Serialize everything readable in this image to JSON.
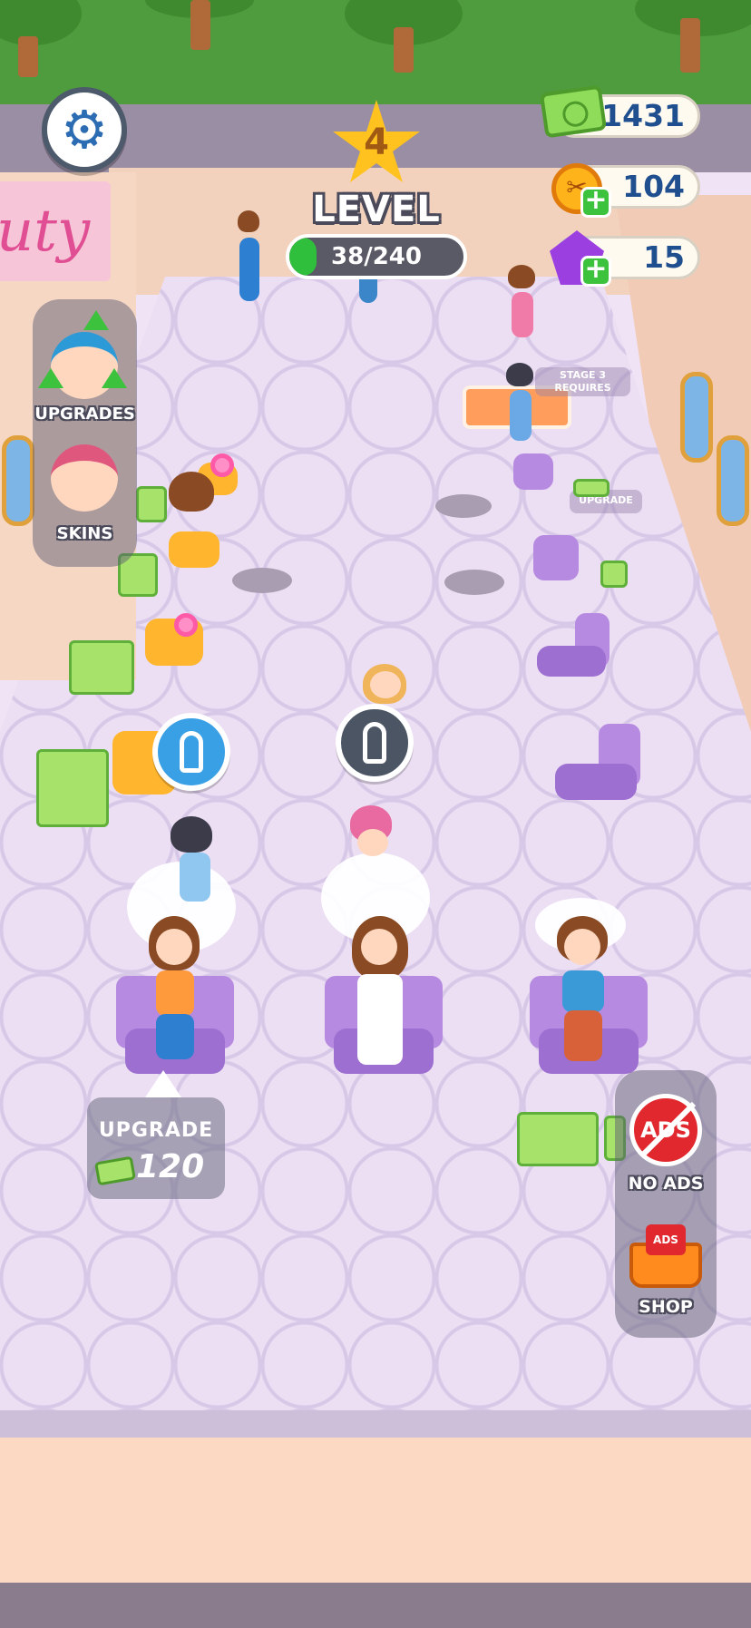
{
  "hud": {
    "level": {
      "number": "4",
      "label": "LEVEL",
      "progress_text": "38/240",
      "progress_fraction": 0.158
    },
    "currencies": {
      "cash": "$1431",
      "scissors_coins": "104",
      "gems": "15"
    },
    "icons": {
      "settings": "gear-icon",
      "cash": "cash-icon",
      "coin": "scissors-coin-icon",
      "gem": "gem-icon"
    }
  },
  "left_panel": {
    "upgrades_label": "UPGRADES",
    "skins_label": "SKINS"
  },
  "right_panel": {
    "no_ads_label": "NO ADS",
    "no_ads_icon_text": "ADS",
    "shop_label": "SHOP",
    "shop_icon_text": "ADS"
  },
  "upgrade_pad": {
    "title": "UPGRADE",
    "cost": "120"
  },
  "world": {
    "sign_text": "uty",
    "stage_tag": "STAGE 3\nREQUIRES",
    "upgrade_tag": "UPGRADE"
  },
  "colors": {
    "accent_green": "#2fbf3c",
    "currency_text": "#1f4f8f",
    "star": "#ffc21e",
    "ads_red": "#e0282e"
  }
}
